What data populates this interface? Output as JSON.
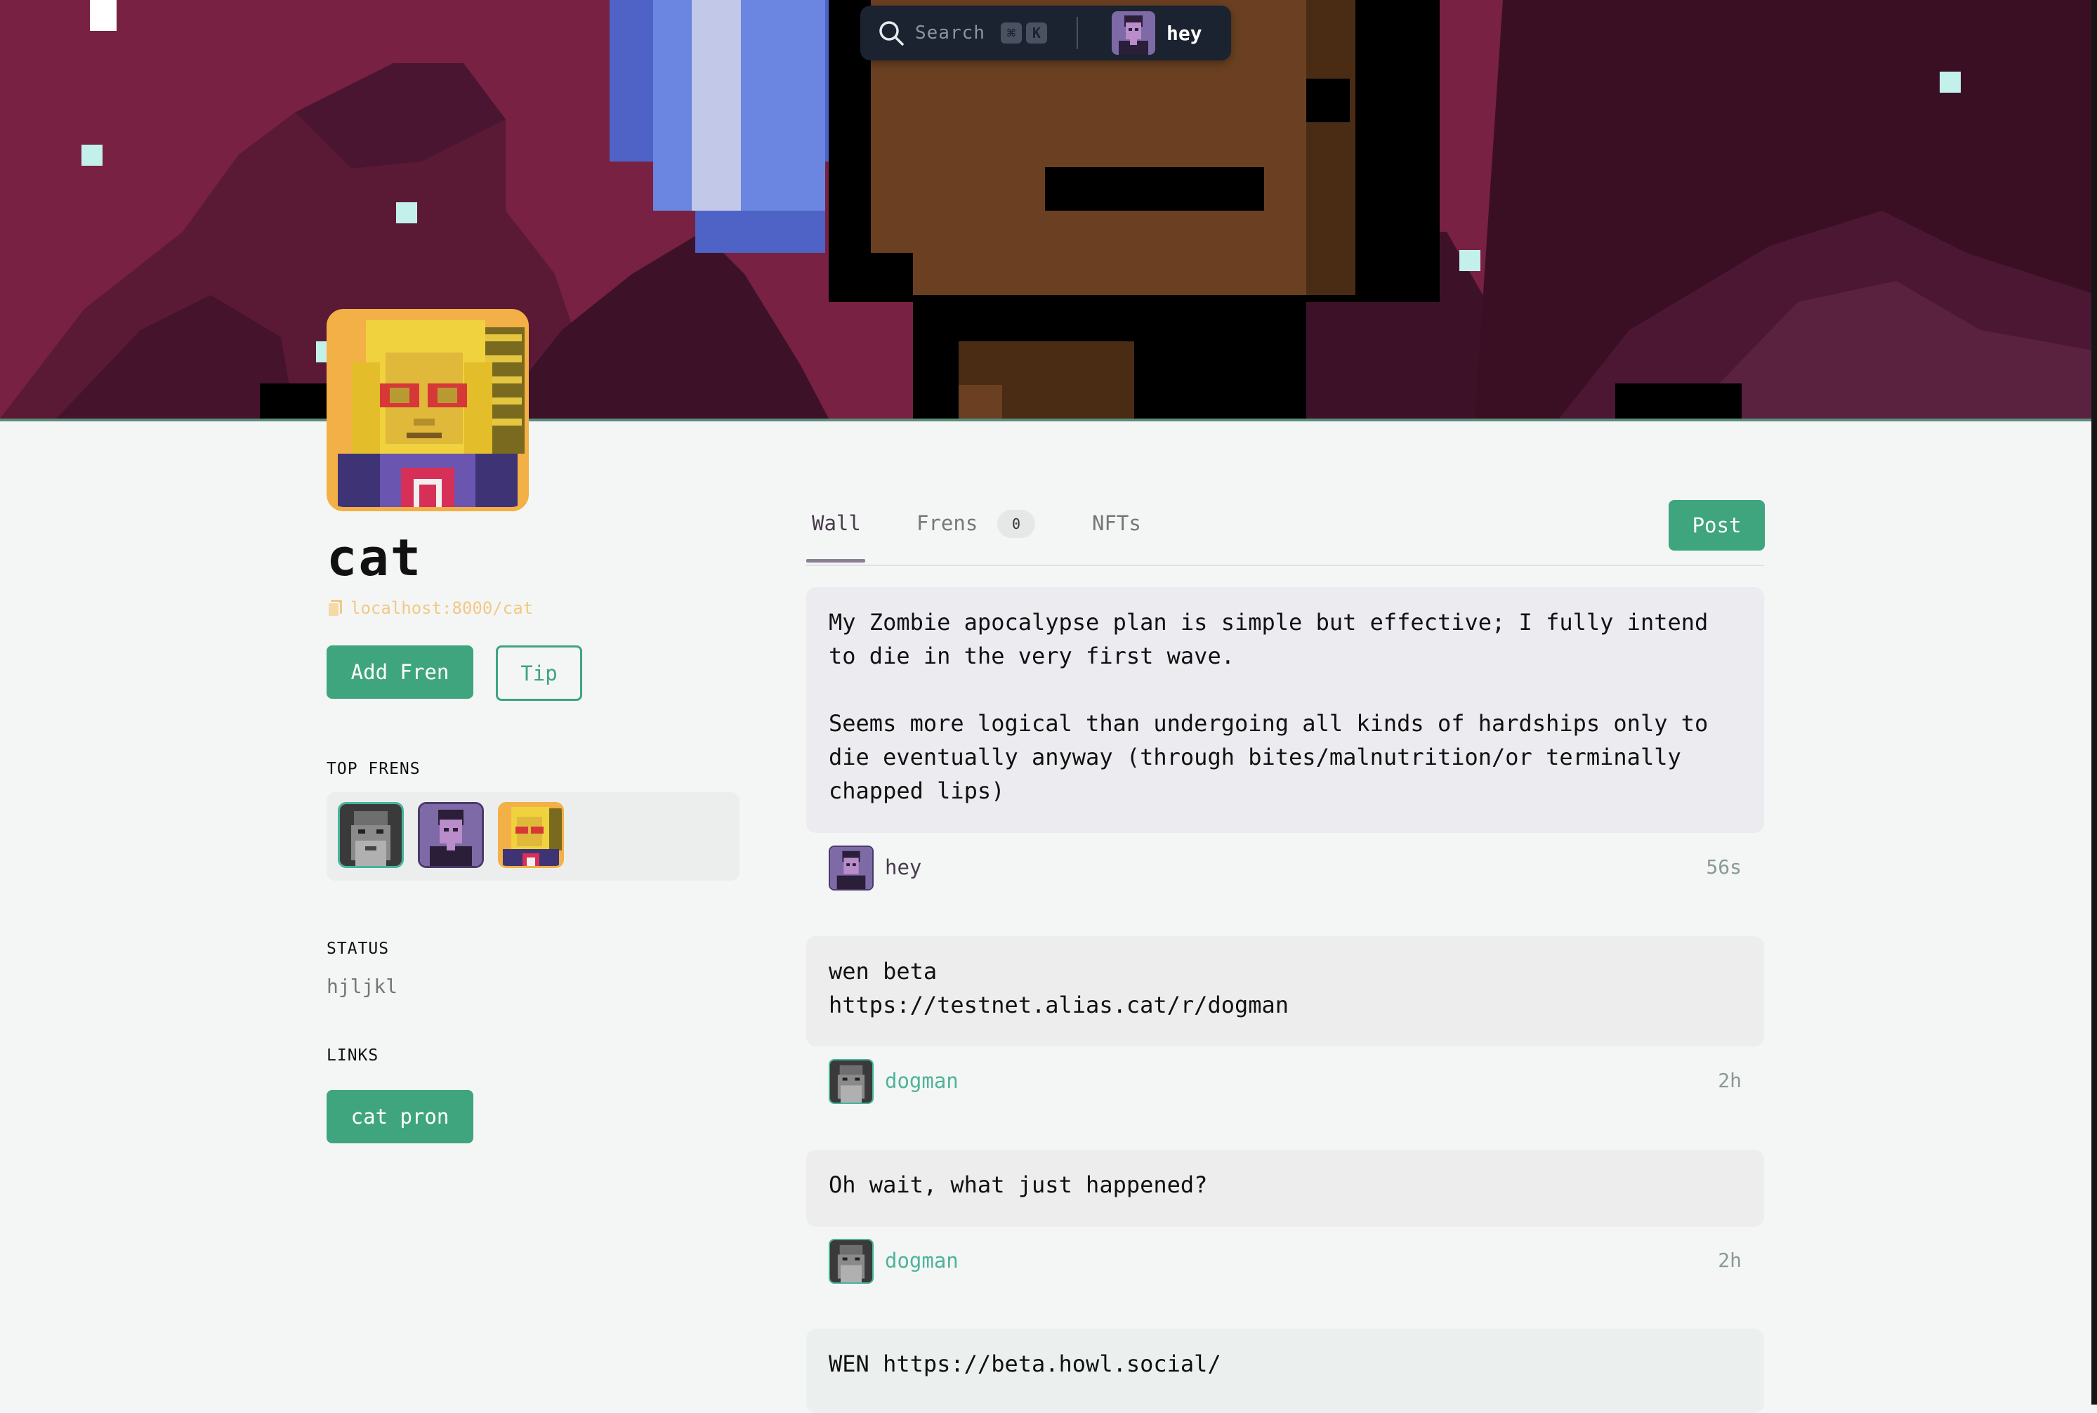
{
  "topbar": {
    "search_placeholder": "Search",
    "shortcut_keys": [
      "⌘",
      "K"
    ],
    "user_name": "hey"
  },
  "profile": {
    "name": "cat",
    "url": "localhost:8000/cat",
    "add_fren_label": "Add Fren",
    "tip_label": "Tip"
  },
  "sidebar": {
    "top_frens_label": "TOP FRENS",
    "top_frens": [
      {
        "name": "dogman",
        "avatar_icon": "bearded-man-avatar"
      },
      {
        "name": "hey",
        "avatar_icon": "purple-person-avatar"
      },
      {
        "name": "cat",
        "avatar_icon": "blonde-woman-avatar"
      }
    ],
    "status_label": "STATUS",
    "status_value": "hjljkl",
    "links_label": "LINKS",
    "links": [
      {
        "label": "cat pron"
      }
    ]
  },
  "tabs": [
    {
      "label": "Wall",
      "active": true
    },
    {
      "label": "Frens",
      "count": "0"
    },
    {
      "label": "NFTs"
    }
  ],
  "post_button_label": "Post",
  "posts": [
    {
      "text": "My Zombie apocalypse plan is simple but effective; I fully intend\nto die in the very first wave.\n\nSeems more logical than undergoing all kinds of hardships only to\ndie eventually anyway (through bites/malnutrition/or terminally\nchapped lips)",
      "author": "hey",
      "time": "56s",
      "card_color": "#ecebef",
      "author_color": "#4a3a4e"
    },
    {
      "text": "wen beta\nhttps://testnet.alias.cat/r/dogman",
      "author": "dogman",
      "time": "2h",
      "card_color": "#ecedec",
      "author_color": "#4fb39a"
    },
    {
      "text": "Oh wait, what just happened?",
      "author": "dogman",
      "time": "2h",
      "card_color": "#ecedec",
      "author_color": "#4fb39a"
    },
    {
      "text": "WEN https://beta.howl.social/",
      "card_color": "#ebf0ef"
    }
  ],
  "colors": {
    "accent": "#3fa57e",
    "banner_bg": "#782142",
    "url_text": "#f2c886"
  }
}
